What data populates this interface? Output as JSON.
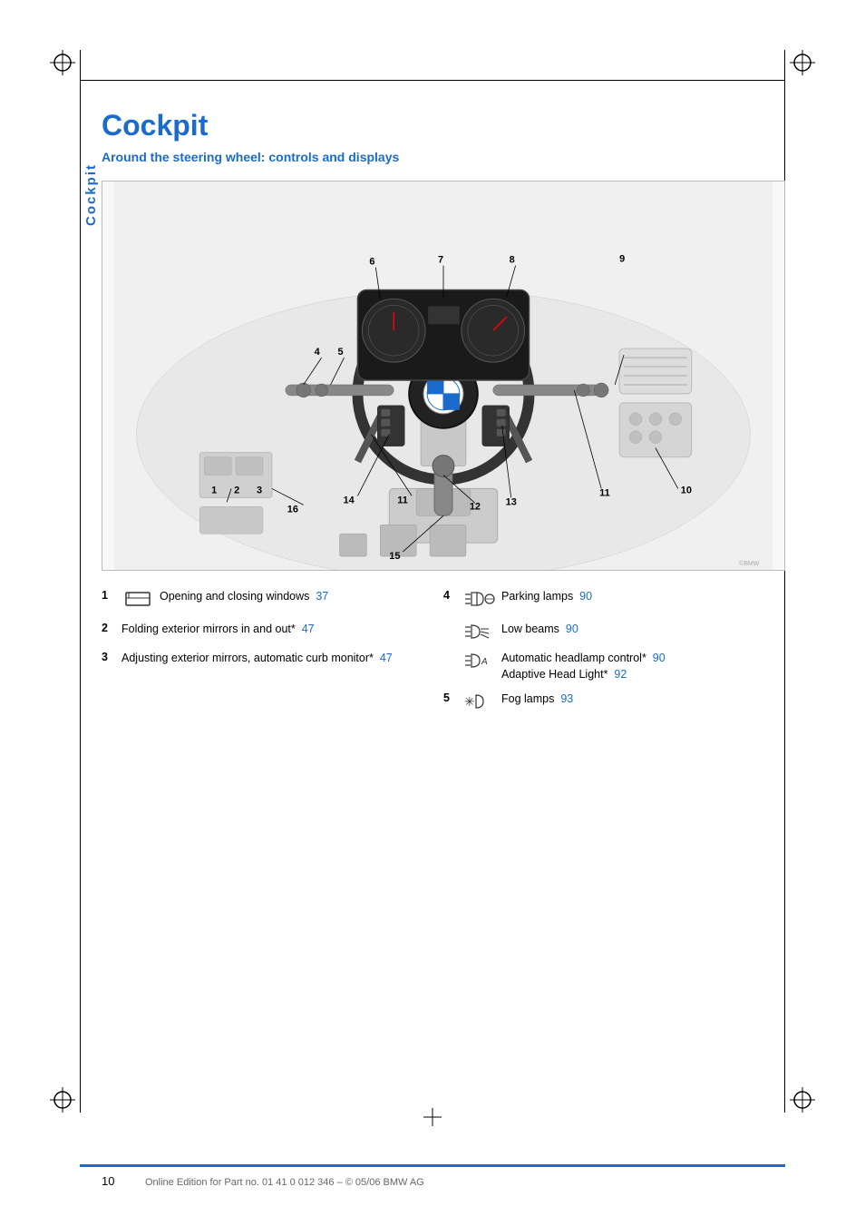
{
  "page": {
    "title": "Cockpit",
    "subtitle": "Around the steering wheel: controls and displays",
    "sidebar_label": "Cockpit",
    "page_number": "10",
    "footer_text": "Online Edition for Part no. 01 41 0 012 346 – © 05/06 BMW AG"
  },
  "legend": {
    "items": [
      {
        "num": "1",
        "icon_name": "window-icon",
        "icon_symbol": "▭",
        "text": "Opening and closing windows",
        "page_ref": "37",
        "has_icon": true
      },
      {
        "num": "2",
        "icon_name": null,
        "text": "Folding exterior mirrors in and out*",
        "page_ref": "47",
        "has_icon": false,
        "asterisk": true
      },
      {
        "num": "3",
        "icon_name": null,
        "text": "Adjusting exterior mirrors, automatic curb monitor*",
        "page_ref": "47",
        "has_icon": false,
        "asterisk": true
      },
      {
        "num": "4",
        "icon_name": "parking-lamps-icon",
        "text": "Parking lamps",
        "page_ref": "90",
        "has_icon": true,
        "sub_items": [
          {
            "icon_name": "low-beams-icon",
            "text": "Low beams",
            "page_ref": "90"
          },
          {
            "icon_name": "auto-headlamp-icon",
            "text": "Automatic headlamp control*",
            "page_ref": "90",
            "text2": "Adaptive Head Light*",
            "page_ref2": "92"
          }
        ]
      },
      {
        "num": "5",
        "icon_name": "fog-lamps-icon",
        "text": "Fog lamps",
        "page_ref": "93",
        "has_icon": true
      }
    ],
    "diagram_labels": [
      "1",
      "2",
      "3",
      "4",
      "5",
      "6",
      "7",
      "8",
      "9",
      "10",
      "11",
      "11",
      "12",
      "13",
      "14",
      "15",
      "16"
    ]
  }
}
